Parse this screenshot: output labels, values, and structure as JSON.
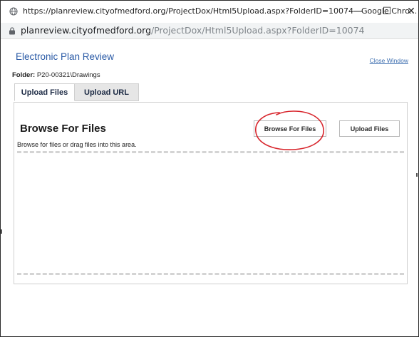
{
  "window": {
    "title": "https://planreview.cityofmedford.org/ProjectDox/Html5Upload.aspx?FolderID=10074 - Google Chro...",
    "minimize_glyph": "—",
    "maximize_glyph": "☐",
    "close_glyph": "✕"
  },
  "address_bar": {
    "host": "planreview.cityofmedford.org",
    "path": "/ProjectDox/Html5Upload.aspx?FolderID=10074",
    "icon": "lock-icon"
  },
  "page": {
    "title": "Electronic Plan Review",
    "close_window_label": "Close Window",
    "folder_label": "Folder:",
    "folder_value": "P20-00321\\Drawings"
  },
  "tabs": [
    {
      "label": "Upload Files",
      "active": true
    },
    {
      "label": "Upload URL",
      "active": false
    }
  ],
  "panel": {
    "heading": "Browse For Files",
    "browse_button_label": "Browse For Files",
    "upload_button_label": "Upload Files",
    "drop_hint": "Browse for files or drag files into this area."
  },
  "colors": {
    "link_blue": "#2a5aa6",
    "annotation_red": "#d8262d",
    "tab_inactive_bg": "#e6e6e6"
  }
}
